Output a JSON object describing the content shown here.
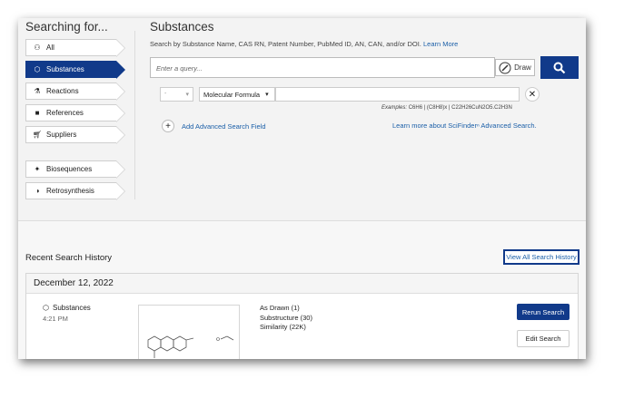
{
  "sidebar": {
    "title": "Searching for...",
    "items": [
      {
        "label": "All",
        "icon": "all-icon"
      },
      {
        "label": "Substances",
        "icon": "substance-icon"
      },
      {
        "label": "Reactions",
        "icon": "reaction-flask-icon"
      },
      {
        "label": "References",
        "icon": "document-icon"
      },
      {
        "label": "Suppliers",
        "icon": "cart-icon"
      },
      {
        "label": "Biosequences",
        "icon": "biosequence-icon"
      },
      {
        "label": "Retrosynthesis",
        "icon": "retrosynthesis-icon"
      }
    ],
    "active_color": "#113a8a"
  },
  "main": {
    "title": "Substances",
    "subtitle": "Search by Substance Name, CAS RN, Patent Number, PubMed ID, AN, CAN, and/or DOI.",
    "learn_more": "Learn More",
    "query_placeholder": "Enter a query...",
    "draw_label": "Draw",
    "advanced": {
      "operator_value": "-",
      "field_value": "Molecular Formula",
      "examples_label": "Examples:",
      "examples": "C6H6 | (C8H8)x | C22H26CuN2O5.C2H3N",
      "add_field": "Add Advanced Search Field",
      "learn_advanced": "Learn more about SciFinderⁿ Advanced Search."
    }
  },
  "history": {
    "title": "Recent Search History",
    "view_all": "View All Search History",
    "date": "December 12, 2022",
    "entry": {
      "type": "Substances",
      "time": "4:21 PM",
      "results": [
        "As Drawn (1)",
        "Substructure (30)",
        "Similarity (22K)"
      ],
      "rerun": "Rerun Search",
      "edit": "Edit Search"
    }
  }
}
